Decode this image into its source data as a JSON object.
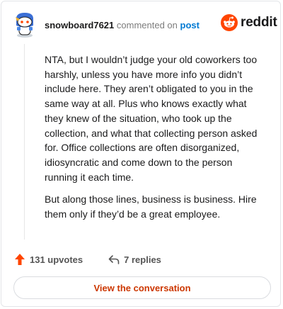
{
  "comment": {
    "username": "snowboard7621",
    "action_text": "commented on",
    "post_link": "post",
    "brand": "reddit",
    "paragraphs": [
      "NTA, but I wouldn’t judge your old coworkers too harshly, unless you have more info you didn’t include here. They aren’t obligated to you in the same way at all. Plus who knows exactly what they knew of the situation, who took up the collection, and what that collecting person asked for. Office collections are often disorganized, idiosyncratic and come down to the person running it each time.",
      "But along those lines, business is business. Hire them only if they’d be a great employee."
    ]
  },
  "footer": {
    "upvotes_label": "131 upvotes",
    "replies_label": "7 replies",
    "cta_label": "View the conversation"
  },
  "colors": {
    "accent": "#ff4500",
    "link": "#0079d3",
    "cta_text": "#cc3700"
  },
  "icons": {
    "avatar": "snoo-avatar",
    "logo": "reddit-snoo-icon",
    "upvote": "upvote-arrow-icon",
    "reply": "reply-arrow-icon"
  }
}
